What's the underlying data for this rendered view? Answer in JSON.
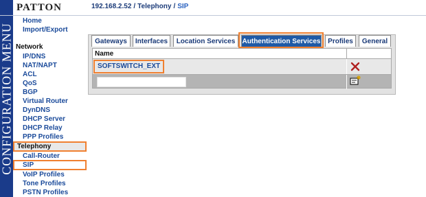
{
  "branding": {
    "logo": "PATTON",
    "side_banner": "CONFIGURATION MENU"
  },
  "breadcrumb": {
    "host": "192.168.2.52",
    "section": "Telephony",
    "page": "SIP",
    "separator": "/"
  },
  "nav": {
    "items": [
      {
        "label": "Home",
        "type": "item"
      },
      {
        "label": "Import/Export",
        "type": "item"
      },
      {
        "label": "Network",
        "type": "section"
      },
      {
        "label": "IP/DNS",
        "type": "item"
      },
      {
        "label": "NAT/NAPT",
        "type": "item"
      },
      {
        "label": "ACL",
        "type": "item"
      },
      {
        "label": "QoS",
        "type": "item"
      },
      {
        "label": "BGP",
        "type": "item"
      },
      {
        "label": "Virtual Router",
        "type": "item"
      },
      {
        "label": "DynDNS",
        "type": "item"
      },
      {
        "label": "DHCP Server",
        "type": "item"
      },
      {
        "label": "DHCP Relay",
        "type": "item"
      },
      {
        "label": "PPP Profiles",
        "type": "item"
      },
      {
        "label": "Telephony",
        "type": "section"
      },
      {
        "label": "Call-Router",
        "type": "item"
      },
      {
        "label": "SIP",
        "type": "item"
      },
      {
        "label": "VoIP Profiles",
        "type": "item"
      },
      {
        "label": "Tone Profiles",
        "type": "item"
      },
      {
        "label": "PSTN Profiles",
        "type": "item"
      }
    ]
  },
  "tabs": [
    {
      "label": "Gateways"
    },
    {
      "label": "Interfaces"
    },
    {
      "label": "Location Services"
    },
    {
      "label": "Authentication Services",
      "active": true
    },
    {
      "label": "Profiles"
    },
    {
      "label": "General"
    }
  ],
  "table": {
    "column_name": "Name",
    "rows": [
      {
        "name": "SOFTSWITCH_EXT"
      }
    ],
    "new_entry_value": ""
  },
  "icons": {
    "delete": "delete-x-icon",
    "add": "add-new-icon"
  },
  "colors": {
    "nav_band": "#1a3b8a",
    "active_tab": "#1f5aa6",
    "highlight": "#f08030",
    "link": "#1a4a9a"
  }
}
